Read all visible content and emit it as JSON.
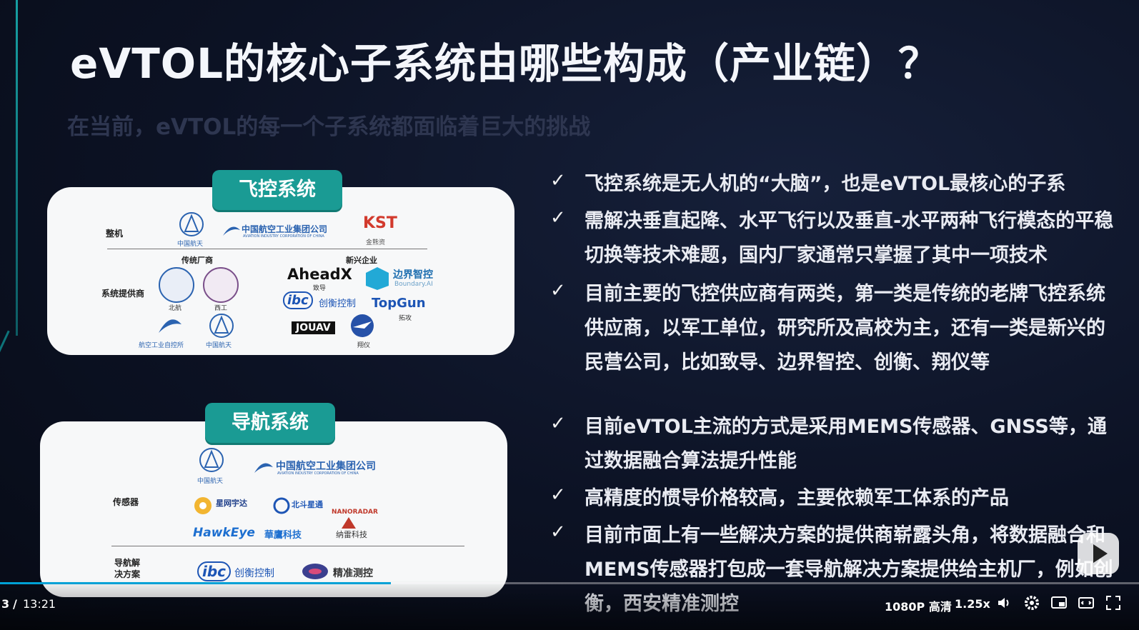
{
  "slide": {
    "title": "eVTOL的核心子系统由哪些构成（产业链）？",
    "subtitle": "在当前，eVTOL的每一个子系统都面临着巨大的挑战"
  },
  "panel_flight": {
    "tag": "飞控系统",
    "row_whole": "整机",
    "row_supplier": "系统提供商",
    "col_traditional": "传统厂商",
    "col_emerging": "新兴企业",
    "logos": {
      "casc": "中国航天",
      "avic": "中国航空工业集团公司",
      "avic_en": "AVIATION INDUSTRY CORPORATION OF CHINA",
      "kst": "KST",
      "kst_caption": "金熊资",
      "uni1": "北航",
      "uni2": "西工",
      "aheadx": "AheadX",
      "aheadx_caption": "致导",
      "boundary": "边界智控",
      "boundary_en": "Boundary.AI",
      "ibc": "ibc",
      "ibc_cn": "创衡控制",
      "topgun": "TopGun",
      "topgun_caption": "拓攻",
      "jouav": "JOUAV",
      "aviation_inst": "航空工业自控所",
      "casc2": "中国航天",
      "xy": "翔仪"
    }
  },
  "panel_nav": {
    "tag": "导航系统",
    "row_sensor": "传感器",
    "row_solution": "导航解决方案",
    "logos": {
      "casc": "中国航天",
      "avic": "中国航空工业集团公司",
      "avic_en": "AVIATION INDUSTRY CORPORATION OF CHINA",
      "xw": "星网宇达",
      "bd": "北斗星通",
      "hawkeye": "HawkEye",
      "hawkeye_cn": "華鷹科技",
      "nano": "NANORADAR",
      "nano_cn": "纳雷科技",
      "ibc": "ibc",
      "ibc_cn": "创衡控制",
      "jz": "精准测控"
    }
  },
  "bullets": [
    "飞控系统是无人机的“大脑”，也是eVTOL最核心的子系",
    "需解决垂直起降、水平飞行以及垂直-水平两种飞行模态的平稳切换等技术难题，国内厂家通常只掌握了其中一项技术",
    "目前主要的飞控供应商有两类，第一类是传统的老牌飞控系统供应商，以军工单位，研究所及高校为主，还有一类是新兴的民营公司，比如致导、边界智控、创衡、翔仪等",
    "目前eVTOL主流的方式是采用MEMS传感器、GNSS等，通过数据融合算法提升性能",
    "高精度的惯导价格较高，主要依赖军工体系的产品",
    "目前市面上有一些解决方案的提供商崭露头角，将数据融合和MEMS传感器打包成一套导航解决方案提供给主机厂，例如创衡，西安精准测控"
  ],
  "player": {
    "time_current": "3",
    "time_sep": "/",
    "time_total": "13:21",
    "quality": "1080P 高清",
    "speed": "1.25x",
    "progress": 0.343
  }
}
